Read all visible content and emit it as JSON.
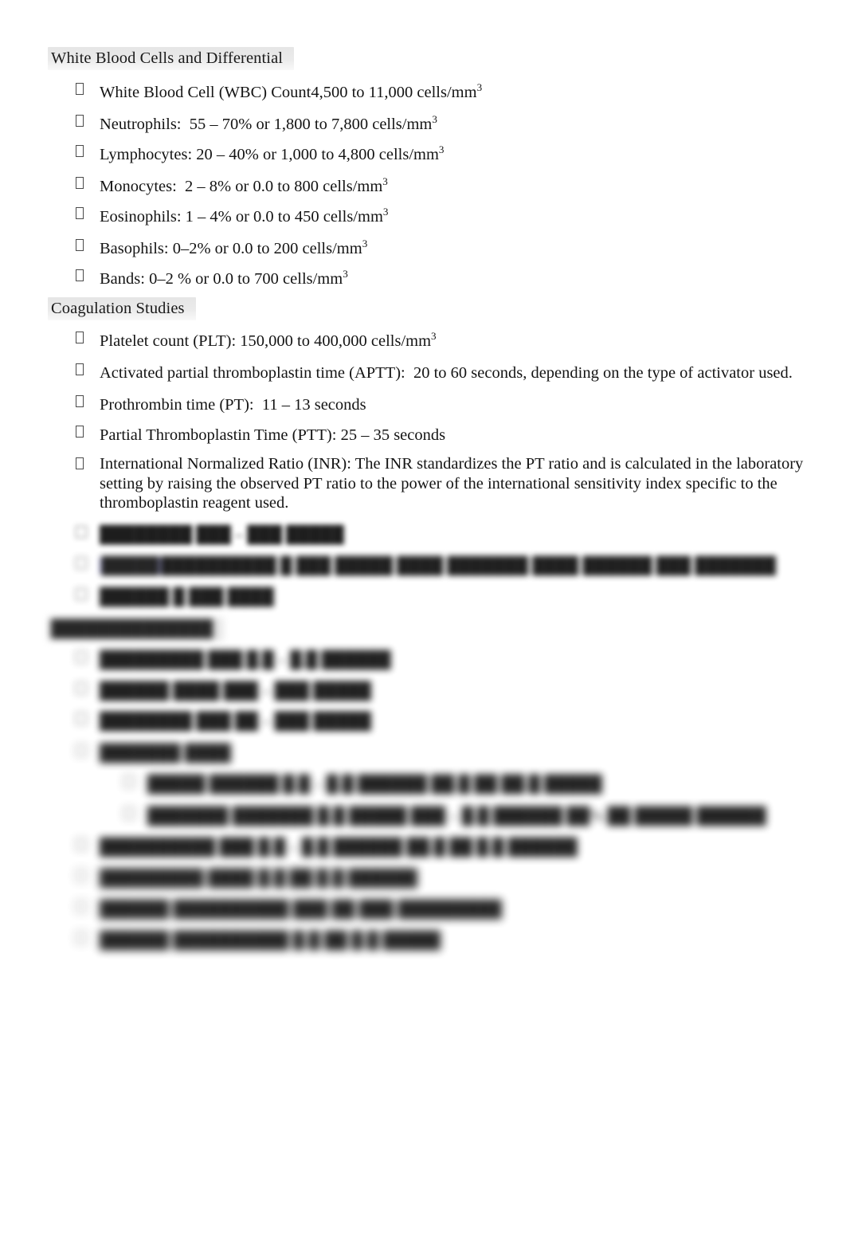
{
  "document": {
    "page_background": "#ffffff",
    "text_color": "#141414",
    "heading_highlight_color": "#e8e8e8",
    "selection_highlight_color": "#aeaef2"
  },
  "sections": [
    {
      "id": "wbc",
      "heading": "White Blood Cells and Differential",
      "items": [
        {
          "text": "White Blood Cell (WBC) Count4,500 to 11,000 cells/mm³"
        },
        {
          "text": "Neutrophils:  55 – 70% or 1,800 to 7,800 cells/mm³"
        },
        {
          "text": "Lymphocytes: 20 – 40% or 1,000 to 4,800 cells/mm³"
        },
        {
          "text": "Monocytes:  2 – 8% or 0.0 to 800 cells/mm³"
        },
        {
          "text": "Eosinophils: 1 – 4% or 0.0 to 450 cells/mm³"
        },
        {
          "text": "Basophils: 0–2% or 0.0 to 200 cells/mm³"
        },
        {
          "text": "Bands: 0–2 % or 0.0 to 700 cells/mm³"
        }
      ]
    },
    {
      "id": "coagulation",
      "heading": "Coagulation Studies",
      "items": [
        {
          "text": "Platelet count (PLT): 150,000 to 400,000 cells/mm³"
        },
        {
          "text": "Activated partial thromboplastin time (APTT):  20 to 60 seconds, depending on the type of activator used."
        },
        {
          "text": "Prothrombin time (PT):  11 – 13 seconds"
        },
        {
          "text": "Partial Thromboplastin Time (PTT): 25 – 35 seconds"
        },
        {
          "text": "International Normalized Ratio (INR): The INR standardizes the PT ratio and is calculated in the laboratory setting by raising the observed PT ratio to the power of the international sensitivity index specific to the thromboplastin reagent used."
        }
      ]
    }
  ],
  "obscured": {
    "note": "Lower portion of the page is rendered out of focus and is not legible.",
    "coagulation_tail": [
      {
        "label": "████████",
        "value": "███ – ███ █████",
        "blur": "b1",
        "selected": false
      },
      {
        "label": "██████████",
        "value": "█ ███ █████ ████ ███████  ████ ██████ ███ ███████",
        "blur": "b2",
        "selected": true,
        "selected_chars": "█████"
      },
      {
        "label": "██████",
        "value": "█ ███ ████",
        "blur": "b2",
        "selected": false
      }
    ],
    "electrolytes_heading": "██████████████",
    "electrolytes_items": [
      {
        "label": "█████████ ███",
        "value": "█.█ – █.█ ██████",
        "blur": "b3",
        "level": 1
      },
      {
        "label": "██████ ████",
        "value": "███ – ███ █████",
        "blur": "b3",
        "level": 1
      },
      {
        "label": "████████ ███",
        "value": "██ – ███ █████",
        "blur": "b3",
        "level": 1
      },
      {
        "label": "███████ ████",
        "value": "",
        "blur": "b4",
        "level": 1
      },
      {
        "label": "█████ ██████",
        "value": "█.█ – █.█ ██████ ██.█ ██ ██.█ █████",
        "blur": "b4",
        "level": 2
      },
      {
        "label": "███████ ███████",
        "value": "█.█ █████ ███  – █.█ ██████ ██% ██ █████ ██████",
        "blur": "b4",
        "level": 2
      },
      {
        "label": "██████████ ███",
        "value": "█.█ – █.█ ██████ ██.█ ██ █.█ ██████",
        "blur": "b4",
        "level": 1
      },
      {
        "label": "█████████ ████",
        "value": "█.█ ██ █.█ ██████",
        "blur": "b5",
        "level": 1
      },
      {
        "label": "██████ ██████████",
        "value": "███ ██ ███ █████████",
        "blur": "b5",
        "level": 1
      },
      {
        "label": "██████ ██████████",
        "value": "█.█ ██ █.█ █████",
        "blur": "b5",
        "level": 1
      }
    ]
  }
}
